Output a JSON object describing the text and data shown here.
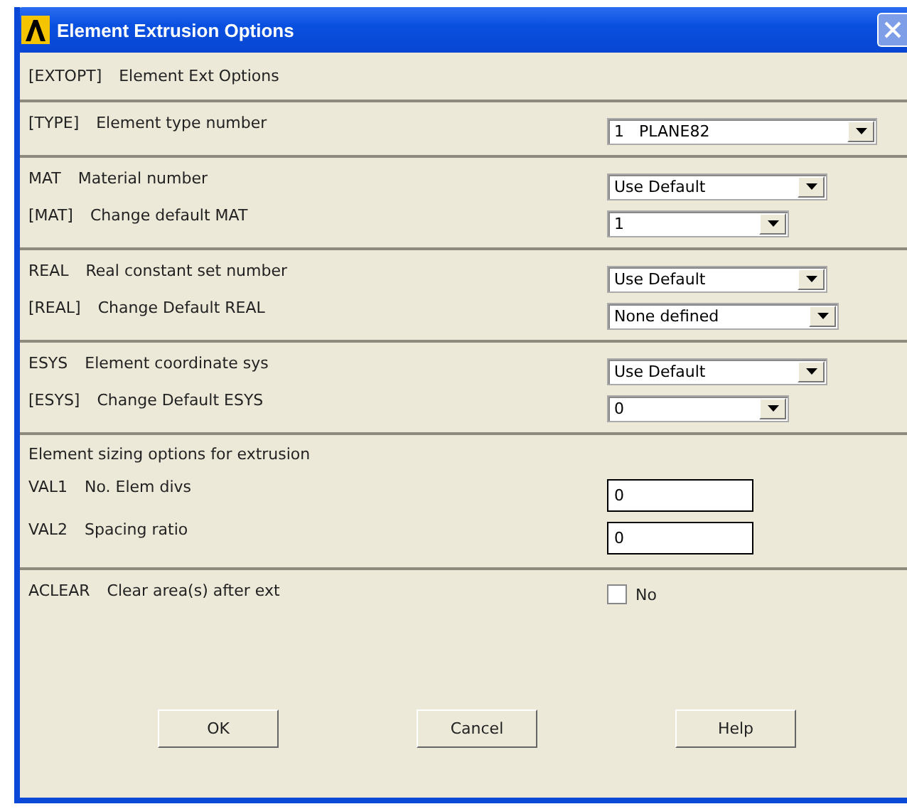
{
  "window": {
    "title": "Element Extrusion Options",
    "close_disabled": true
  },
  "sections": [
    {
      "rows": [
        {
          "kind": "text",
          "code": "[EXTOPT]",
          "label": "Element Ext Options"
        }
      ]
    },
    {
      "rows": [
        {
          "kind": "dropdown",
          "code": "[TYPE]",
          "label": "Element type number",
          "value": "1   PLANE82"
        }
      ]
    },
    {
      "rows": [
        {
          "kind": "dropdown",
          "code": "MAT",
          "label": "Material number",
          "value": "Use Default"
        },
        {
          "kind": "dropdown",
          "code": "[MAT]",
          "label": "Change default MAT",
          "value": "1"
        }
      ]
    },
    {
      "rows": [
        {
          "kind": "dropdown",
          "code": "REAL",
          "label": "Real constant set number",
          "value": "Use Default"
        },
        {
          "kind": "dropdown",
          "code": "[REAL]",
          "label": "Change Default REAL",
          "value": "None defined"
        }
      ]
    },
    {
      "rows": [
        {
          "kind": "dropdown",
          "code": "ESYS",
          "label": "Element coordinate sys",
          "value": "Use Default"
        },
        {
          "kind": "dropdown",
          "code": "[ESYS]",
          "label": "Change Default ESYS",
          "value": "0"
        }
      ]
    },
    {
      "rows": [
        {
          "kind": "heading",
          "label": "Element sizing options for extrusion"
        },
        {
          "kind": "input",
          "code": "VAL1",
          "label": "No. Elem divs",
          "value": "0"
        },
        {
          "kind": "input",
          "code": "VAL2",
          "label": "Spacing ratio",
          "value": "0"
        }
      ]
    },
    {
      "rows": [
        {
          "kind": "checkbox",
          "code": "ACLEAR",
          "label": "Clear area(s) after ext",
          "value": "No",
          "checked": false
        }
      ]
    }
  ],
  "buttons": [
    "OK",
    "Cancel",
    "Help"
  ]
}
